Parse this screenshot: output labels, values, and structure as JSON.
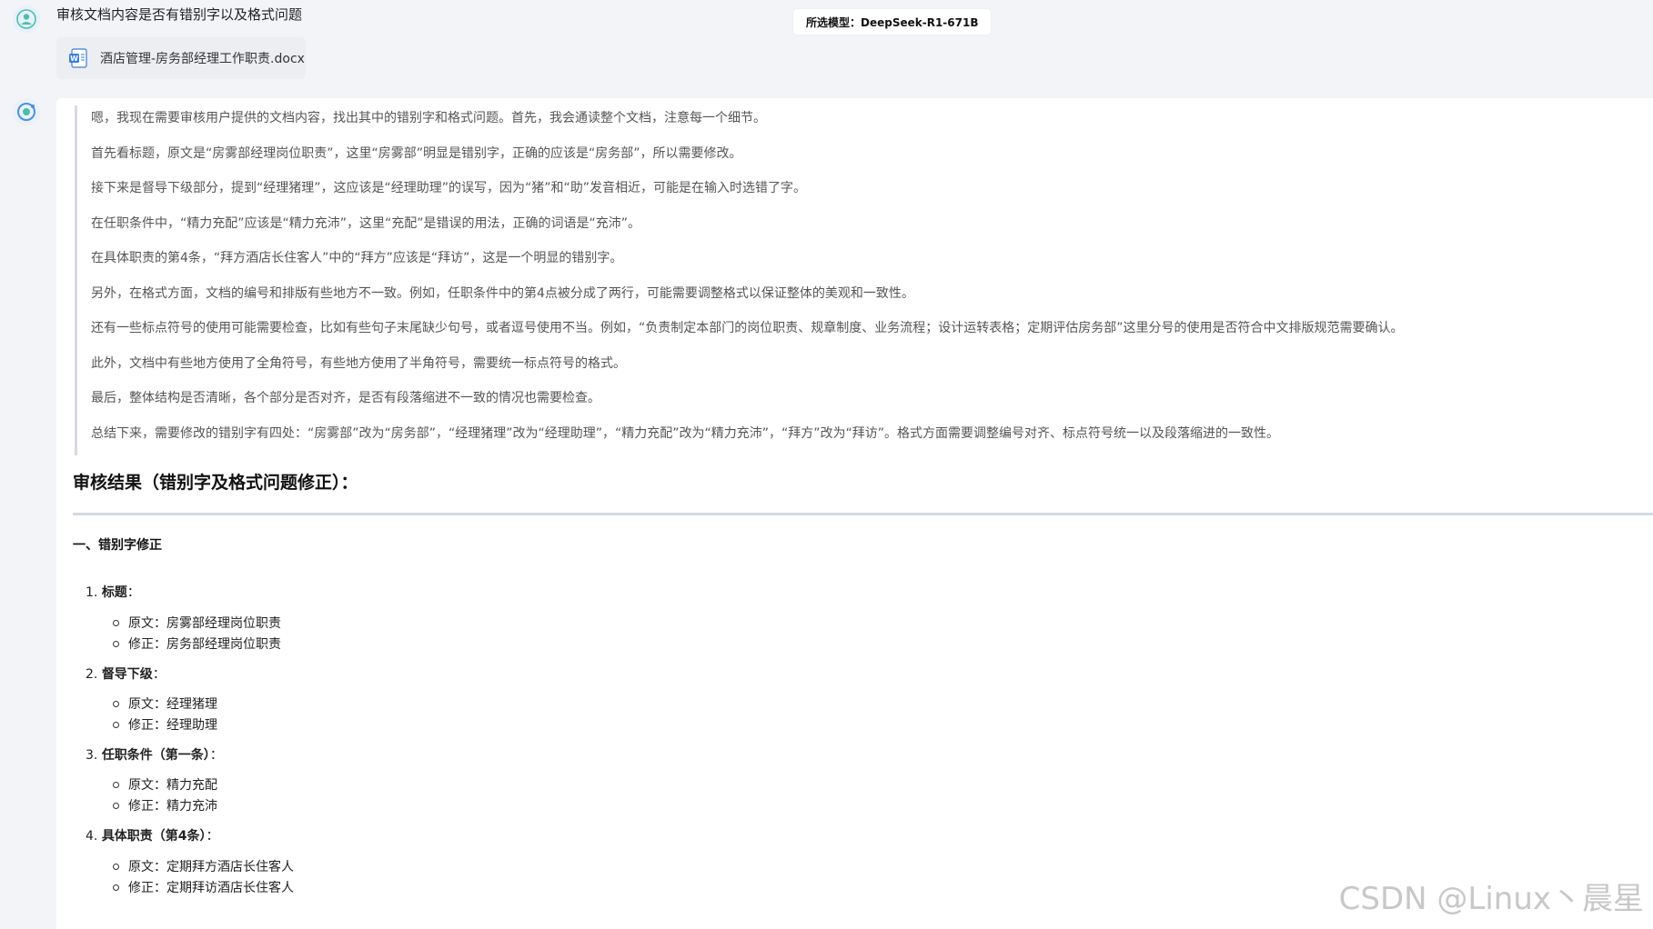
{
  "user": {
    "message": "审核文档内容是否有错别字以及格式问题",
    "file_name": "酒店管理-房务部经理工作职责.docx"
  },
  "model_tag": "所选模型：DeepSeek-R1-671B",
  "thinking": [
    "嗯，我现在需要审核用户提供的文档内容，找出其中的错别字和格式问题。首先，我会通读整个文档，注意每一个细节。",
    "首先看标题，原文是“房雾部经理岗位职责”，这里“房雾部”明显是错别字，正确的应该是“房务部”，所以需要修改。",
    "接下来是督导下级部分，提到“经理猪理”，这应该是“经理助理”的误写，因为“猪”和“助”发音相近，可能是在输入时选错了字。",
    "在任职条件中，“精力充配”应该是“精力充沛”，这里“充配”是错误的用法，正确的词语是“充沛”。",
    "在具体职责的第4条，“拜方酒店长住客人”中的“拜方”应该是“拜访”，这是一个明显的错别字。",
    "另外，在格式方面，文档的编号和排版有些地方不一致。例如，任职条件中的第4点被分成了两行，可能需要调整格式以保证整体的美观和一致性。",
    "还有一些标点符号的使用可能需要检查，比如有些句子末尾缺少句号，或者逗号使用不当。例如，“负责制定本部门的岗位职责、规章制度、业务流程；设计运转表格；定期评估房务部”这里分号的使用是否符合中文排版规范需要确认。",
    "此外，文档中有些地方使用了全角符号，有些地方使用了半角符号，需要统一标点符号的格式。",
    "最后，整体结构是否清晰，各个部分是否对齐，是否有段落缩进不一致的情况也需要检查。",
    "总结下来，需要修改的错别字有四处：“房雾部”改为“房务部”，“经理猪理”改为“经理助理”，“精力充配”改为“精力充沛”，“拜方”改为“拜访”。格式方面需要调整编号对齐、标点符号统一以及段落缩进的一致性。"
  ],
  "result": {
    "title": "审核结果（错别字及格式问题修正）：",
    "section1_title": "一、错别字修正",
    "items": [
      {
        "num": "1.",
        "label": "标题",
        "suffix": "：",
        "original": "原文：房雾部经理岗位职责",
        "fixed": "修正：房务部经理岗位职责"
      },
      {
        "num": "2.",
        "label": "督导下级",
        "suffix": "：",
        "original": "原文：经理猪理",
        "fixed": "修正：经理助理"
      },
      {
        "num": "3.",
        "label": "任职条件（第一条）",
        "suffix": "：",
        "original": "原文：精力充配",
        "fixed": "修正：精力充沛"
      },
      {
        "num": "4.",
        "label": "具体职责（第4条）",
        "suffix": "：",
        "original": "原文：定期拜方酒店长住客人",
        "fixed": "修正：定期拜访酒店长住客人"
      }
    ]
  },
  "watermark": "CSDN @Linux丶晨星",
  "colors": {
    "background": "#f2f4f7",
    "card": "#ffffff",
    "thinking_border": "#d7dae0",
    "divider": "#d3d9e2",
    "accent": "#4a90e2"
  }
}
